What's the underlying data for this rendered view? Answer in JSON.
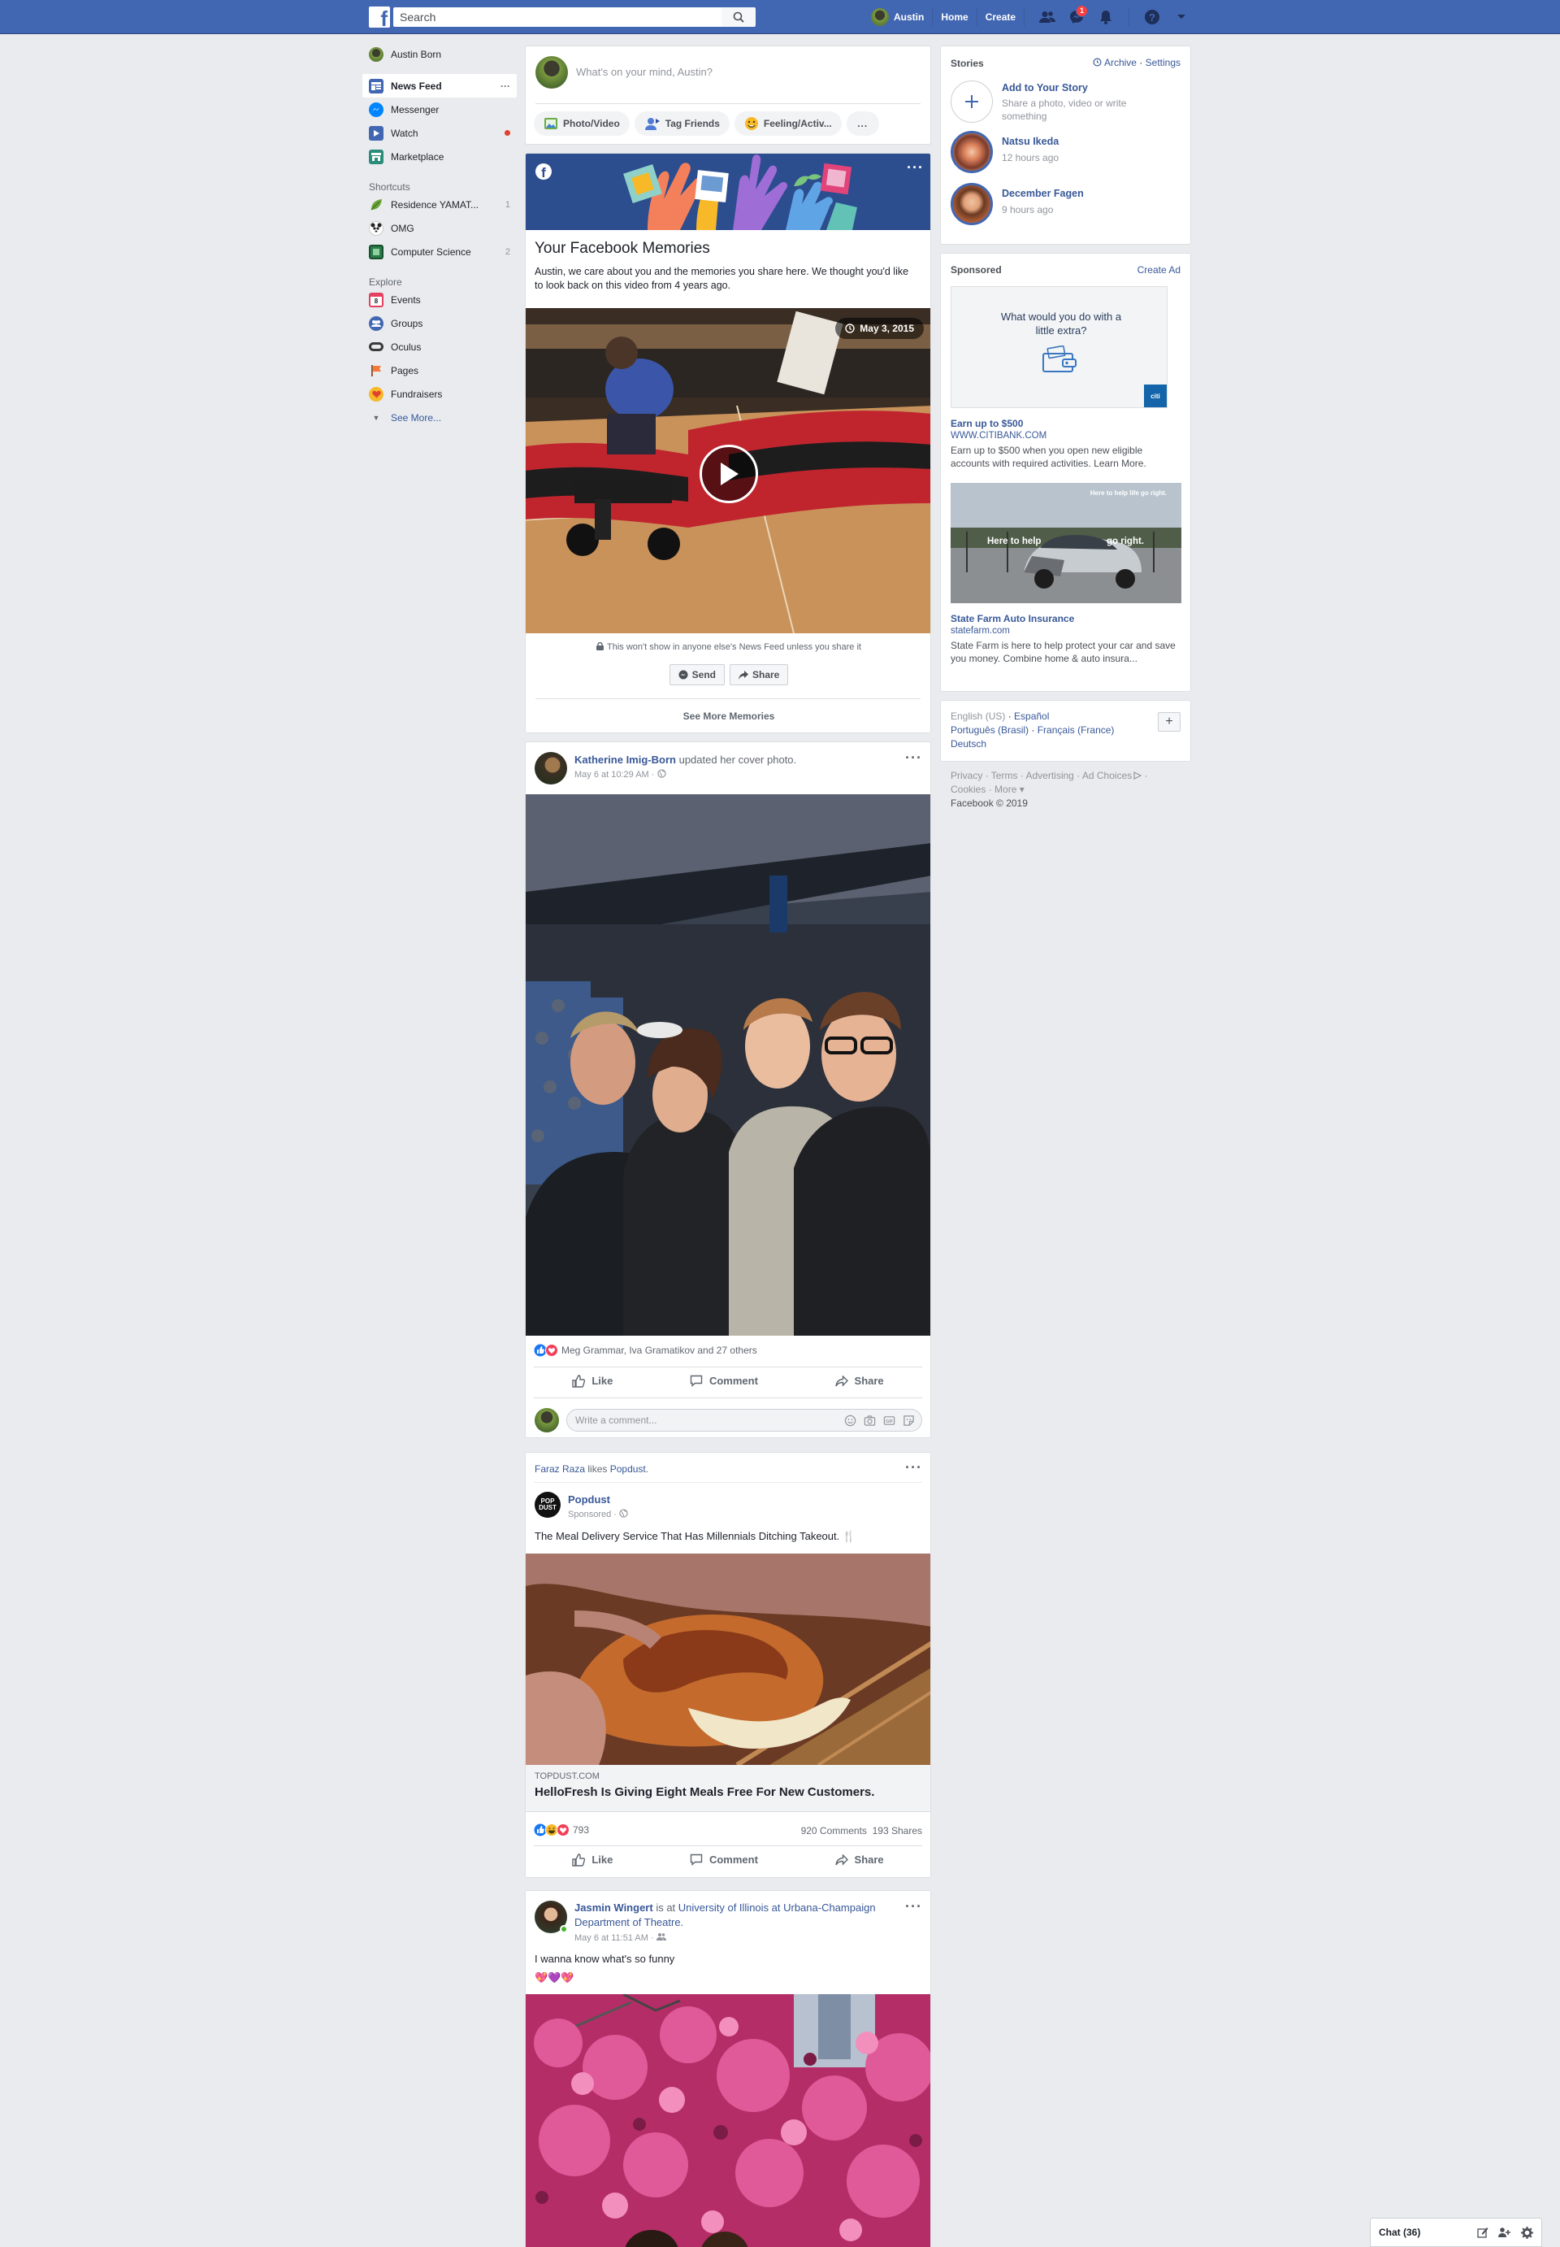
{
  "topbar": {
    "search_placeholder": "Search",
    "user": "Austin",
    "home": "Home",
    "create": "Create",
    "messenger_badge": "1"
  },
  "leftnav": {
    "profile": "Austin Born",
    "main": [
      {
        "label": "News Feed",
        "icon": "news-feed-icon",
        "color": "#4267b2"
      },
      {
        "label": "Messenger",
        "icon": "messenger-icon",
        "color": "#0084ff"
      },
      {
        "label": "Watch",
        "icon": "watch-icon",
        "color": "#4267b2"
      },
      {
        "label": "Marketplace",
        "icon": "marketplace-icon",
        "color": "#2a8c7a"
      }
    ],
    "shortcuts_heading": "Shortcuts",
    "shortcuts": [
      {
        "label": "Residence YAMAT...",
        "count": "1"
      },
      {
        "label": "OMG",
        "count": ""
      },
      {
        "label": "Computer Science",
        "count": "2"
      }
    ],
    "explore_heading": "Explore",
    "explore": [
      {
        "label": "Events",
        "icon": "events-icon",
        "color": "#e4405f"
      },
      {
        "label": "Groups",
        "icon": "groups-icon",
        "color": "#4267b2"
      },
      {
        "label": "Oculus",
        "icon": "oculus-icon",
        "color": "#3a3a3a"
      },
      {
        "label": "Pages",
        "icon": "pages-icon",
        "color": "#f5793a"
      },
      {
        "label": "Fundraisers",
        "icon": "fundraisers-icon",
        "color": "#e9710f"
      }
    ],
    "see_more": "See More..."
  },
  "composer": {
    "placeholder": "What's on your mind, Austin?",
    "photo": "Photo/Video",
    "tag": "Tag Friends",
    "feeling": "Feeling/Activ...",
    "more": "..."
  },
  "memories": {
    "title": "Your Facebook Memories",
    "text": "Austin, we care about you and the memories you share here. We thought you'd like to look back on this video from 4 years ago.",
    "date": "May 3, 2015",
    "privacy": "This won't show in anyone else's News Feed unless you share it",
    "send": "Send",
    "share": "Share",
    "see_more": "See More Memories"
  },
  "post1": {
    "author": "Katherine Imig-Born",
    "action": "updated her cover photo.",
    "time": "May 6 at 10:29 AM",
    "reactions": "Meg Grammar, Iva Gramatikov and 27 others",
    "like": "Like",
    "comment": "Comment",
    "share": "Share",
    "comment_placeholder": "Write a comment..."
  },
  "post2": {
    "liker": "Faraz Raza",
    "likes_text": "likes",
    "page": "Popdust",
    "sponsored": "Sponsored",
    "text": "The Meal Delivery Service That Has Millennials Ditching Takeout. 🍴",
    "domain": "TOPDUST.COM",
    "headline": "HelloFresh Is Giving Eight Meals Free For New Customers.",
    "reactions": "793",
    "comments": "920 Comments",
    "shares": "193 Shares",
    "like": "Like",
    "comment": "Comment",
    "share": "Share"
  },
  "post3": {
    "author": "Jasmin Wingert",
    "is_at": "is at",
    "place": "University of Illinois at Urbana-Champaign Department of Theatre.",
    "time": "May 6 at 11:51 AM",
    "text": "I wanna know what's so funny",
    "emoji": "💖💜💖"
  },
  "stories": {
    "title": "Stories",
    "archive": "Archive",
    "settings": "Settings",
    "add_title": "Add to Your Story",
    "add_sub": "Share a photo, video or write something",
    "items": [
      {
        "name": "Natsu Ikeda",
        "time": "12 hours ago"
      },
      {
        "name": "December Fagen",
        "time": "9 hours ago"
      }
    ]
  },
  "sponsored": {
    "title": "Sponsored",
    "create_ad": "Create Ad",
    "ad1": {
      "image_text": "What would you do with a little extra?",
      "brand": "citi",
      "title": "Earn up to $500",
      "url": "WWW.CITIBANK.COM",
      "desc": "Earn up to $500 when you open new eligible accounts with required activities. Learn More."
    },
    "ad2": {
      "image_text_left": "Here to help",
      "image_text_right": "go right.",
      "image_tag": "Here to help life go right.",
      "title": "State Farm Auto Insurance",
      "url": "statefarm.com",
      "desc": "State Farm is here to help protect your car and save you money. Combine home & auto insura..."
    }
  },
  "languages": {
    "current": "English (US)",
    "others": [
      "Español",
      "Português (Brasil)",
      "Français (France)",
      "Deutsch"
    ],
    "add": "+"
  },
  "footer": {
    "links": [
      "Privacy",
      "Terms",
      "Advertising",
      "Ad Choices",
      "Cookies",
      "More"
    ],
    "copyright": "Facebook © 2019"
  },
  "chat": {
    "label": "Chat (36)"
  }
}
